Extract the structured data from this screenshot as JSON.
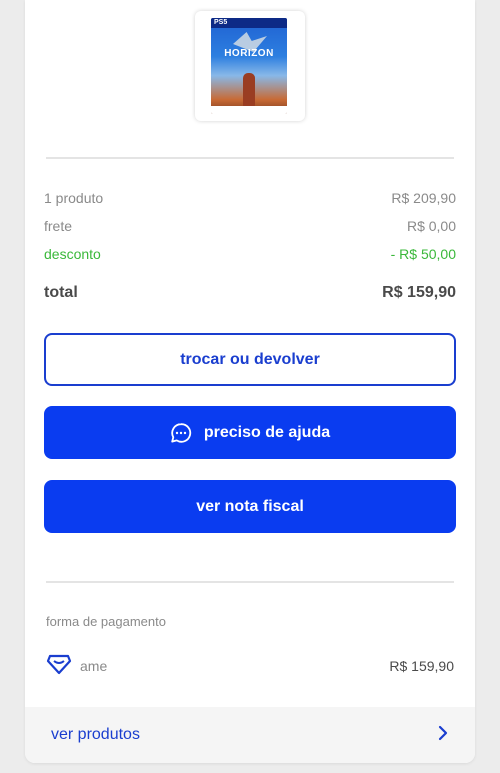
{
  "product": {
    "cover_platform": "PS5",
    "cover_title": "HORIZON"
  },
  "summary": {
    "products_label": "1 produto",
    "products_value": "R$ 209,90",
    "shipping_label": "frete",
    "shipping_value": "R$ 0,00",
    "discount_label": "desconto",
    "discount_value": "- R$ 50,00",
    "total_label": "total",
    "total_value": "R$ 159,90"
  },
  "actions": {
    "exchange_label": "trocar ou devolver",
    "help_label": "preciso de ajuda",
    "invoice_label": "ver nota fiscal"
  },
  "payment": {
    "section_label": "forma de pagamento",
    "method_name": "ame",
    "method_icon": "ame-heart-icon",
    "amount": "R$ 159,90"
  },
  "footer": {
    "label": "ver produtos",
    "icon": "chevron-right-icon"
  },
  "colors": {
    "brand_blue": "#0a3cf0",
    "discount_green": "#3ab83a"
  }
}
